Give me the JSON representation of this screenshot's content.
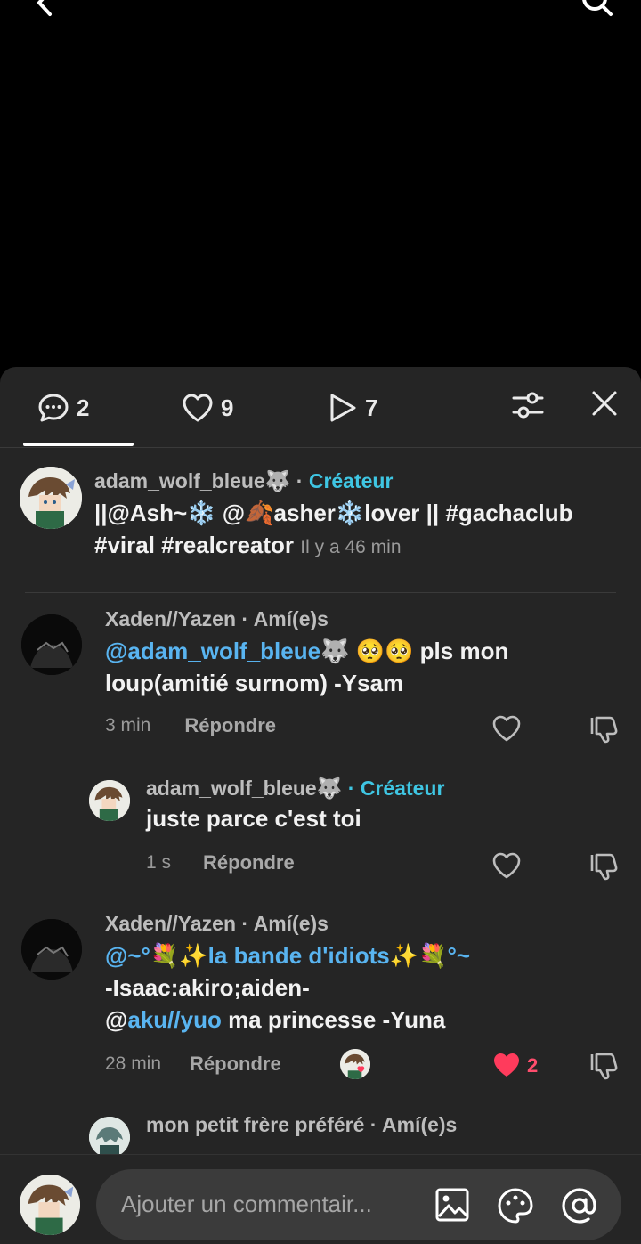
{
  "colors": {
    "creator": "#3fc6e3",
    "mention": "#59b4f0",
    "like_active": "#ff3b5c"
  },
  "tabs": {
    "comments_count": "2",
    "likes_count": "9",
    "plays_count": "7"
  },
  "header_comment": {
    "username": "adam_wolf_bleue🐺",
    "sep": "·",
    "badge": "Créateur",
    "text_line1": "||@Ash~❄️ @🍂asher❄️lover || #gachaclub",
    "text_line2": "#viral #realcreator",
    "time": "Il y a 46 min"
  },
  "comments": [
    {
      "username": "Xaden//Yazen",
      "badge": "· Amí(e)s",
      "mention": "@adam_wolf_bleue🐺",
      "text_a": " 🥺🥺 pls mon",
      "text_b": "loup(amitié surnom) -Ysam",
      "time": "3 min",
      "reply": "Répondre"
    },
    {
      "username": "adam_wolf_bleue🐺",
      "badge": "· Créateur",
      "text": "juste parce c'est toi",
      "time": "1 s",
      "reply": "Répondre"
    },
    {
      "username": "Xaden//Yazen",
      "badge": "· Amí(e)s",
      "mention_line": "@~°💐✨la bande d'idiots✨💐°~",
      "text_line2": "-Isaac:akiro;aiden-",
      "mention2_at": "@",
      "mention2": "aku//yuo",
      "text_line3": " ma princesse -Yuna",
      "time": "28 min",
      "reply": "Répondre",
      "likes": "2"
    },
    {
      "username": "mon petit frère préféré",
      "badge": "· Amí(e)s"
    }
  ],
  "input": {
    "placeholder": "Ajouter un commentair..."
  }
}
